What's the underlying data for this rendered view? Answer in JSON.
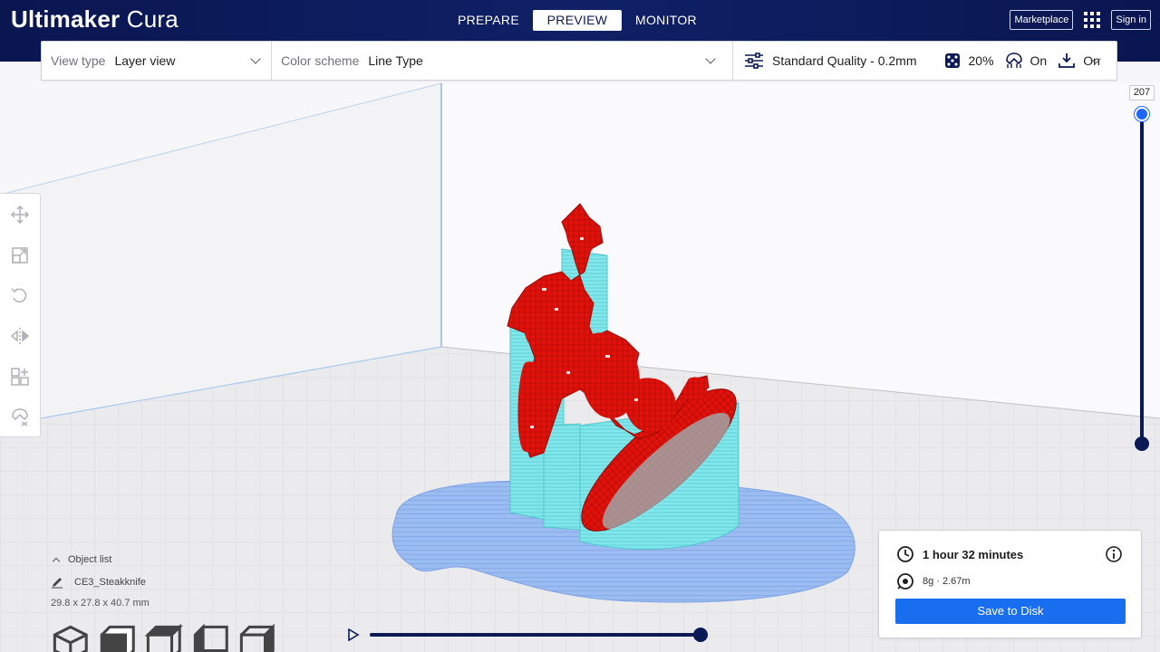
{
  "app": {
    "logo_bold": "Ultimaker",
    "logo_thin": " Cura"
  },
  "header": {
    "stages": [
      "PREPARE",
      "PREVIEW",
      "MONITOR"
    ],
    "active_stage": "PREVIEW",
    "marketplace_label": "Marketplace",
    "signin_label": "Sign in"
  },
  "toolbar": {
    "view_type_label": "View type",
    "view_type_value": "Layer view",
    "color_scheme_label": "Color scheme",
    "color_scheme_value": "Line Type",
    "quality_value": "Standard Quality - 0.2mm",
    "infill_value": "20%",
    "support_value": "On",
    "adhesion_value": "On"
  },
  "left_tools": [
    "move-tool",
    "scale-tool",
    "rotate-tool",
    "mirror-tool",
    "per-model-settings-tool",
    "support-blocker-tool"
  ],
  "layer_slider": {
    "current_layer": "207",
    "position_fraction": 1.0
  },
  "object_info": {
    "list_label": "Object list",
    "object_name": "CE3_Steakknife",
    "dimensions": "29.8 x 27.8 x 40.7 mm"
  },
  "playback": {
    "progress_fraction": 1.0
  },
  "print_info": {
    "time": "1 hour 32 minutes",
    "material": "8g · 2.67m",
    "save_label": "Save to Disk"
  },
  "colors": {
    "header_bg": "#0b1a55",
    "accent_blue": "#196ef0",
    "model_red": "#e3120b",
    "support_cyan": "#7ee6ea",
    "adhesion_blue": "#94b6ee"
  }
}
